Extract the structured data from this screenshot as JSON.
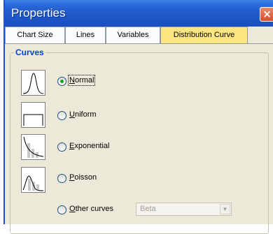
{
  "window": {
    "title": "Properties",
    "close_glyph": "×"
  },
  "tabs": [
    {
      "label": "Chart Size"
    },
    {
      "label": "Lines"
    },
    {
      "label": "Variables"
    },
    {
      "label": "Distribution Curve"
    }
  ],
  "active_tab": "Distribution Curve",
  "curves": {
    "group_label": "Curves",
    "options": [
      {
        "first": "N",
        "rest": "ormal",
        "selected": true,
        "icon": "normal-curve-icon"
      },
      {
        "first": "U",
        "rest": "niform",
        "selected": false,
        "icon": "uniform-curve-icon"
      },
      {
        "first": "E",
        "rest": "xponential",
        "selected": false,
        "icon": "exponential-curve-icon"
      },
      {
        "first": "P",
        "rest": "oisson",
        "selected": false,
        "icon": "poisson-curve-icon"
      },
      {
        "first": "O",
        "rest": "ther curves",
        "selected": false
      }
    ],
    "other_select": {
      "value": "Beta",
      "arrow_glyph": "▼"
    }
  },
  "colors": {
    "title_bar": "#1f58c9",
    "active_tab": "#ffe680",
    "group_label": "#0046d5",
    "radio_dot": "#21a121"
  }
}
